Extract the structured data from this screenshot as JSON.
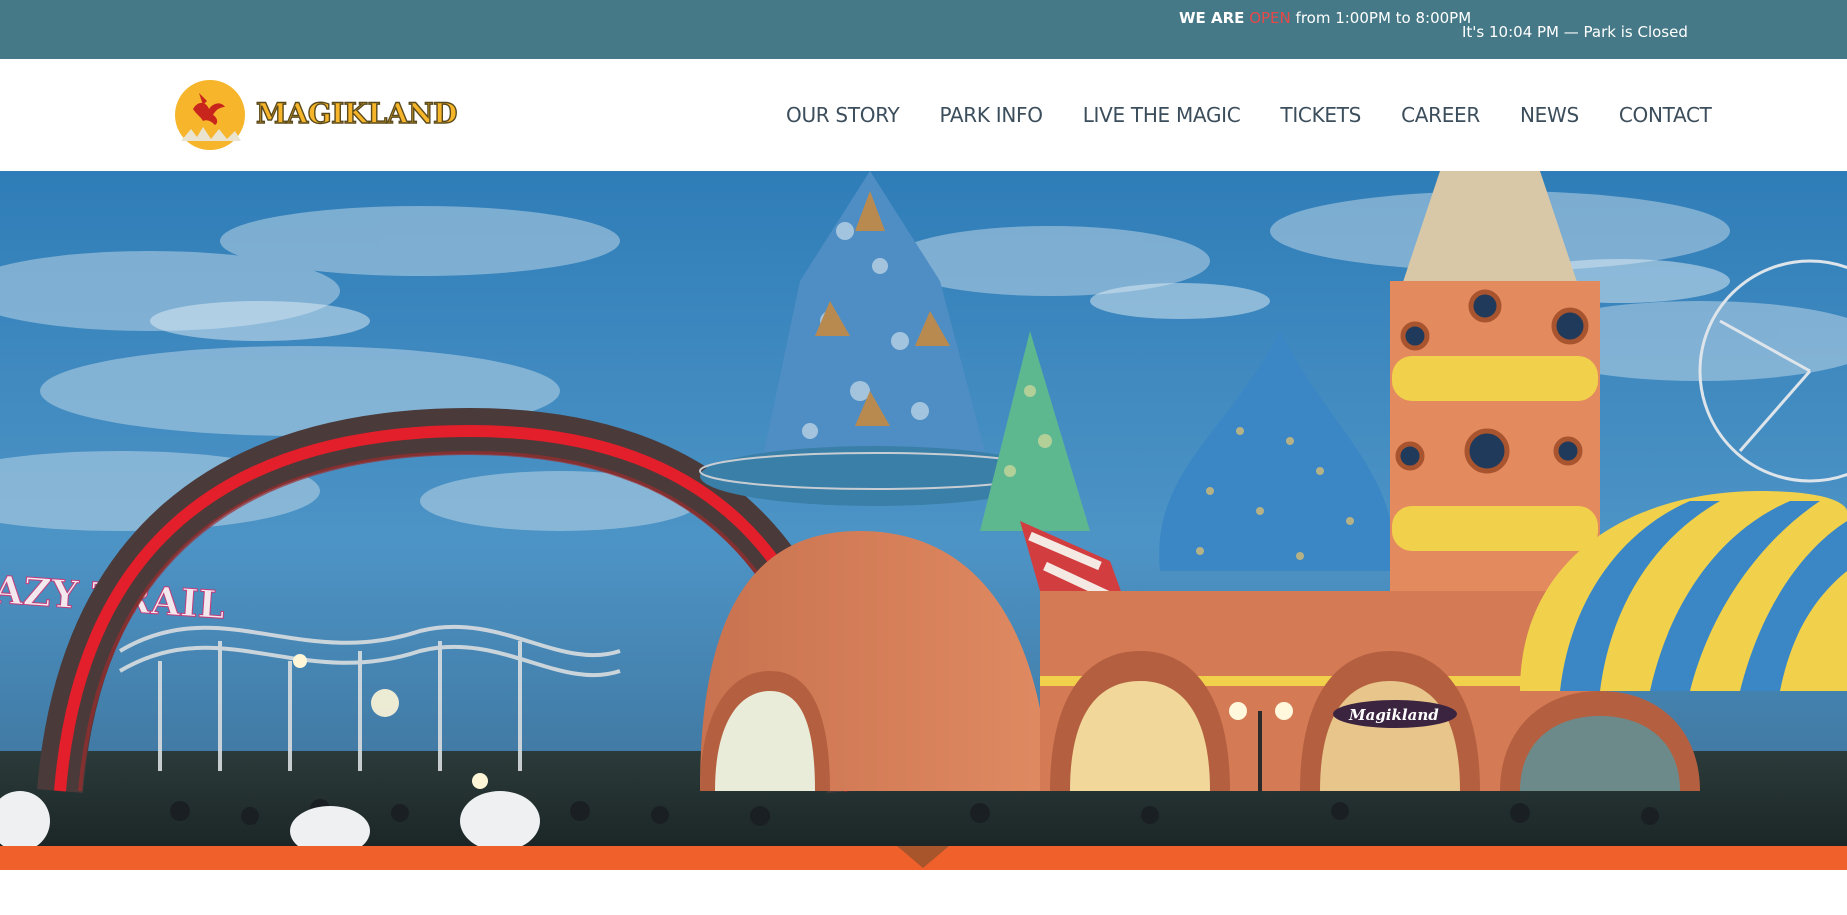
{
  "topbar": {
    "we_are": "WE ARE",
    "open": "OPEN",
    "hours_text": " from 1:00PM to 8:00PM",
    "status": "It's 10:04 PM — Park is Closed"
  },
  "header": {
    "logo_text": "MAGIKLAND"
  },
  "nav": {
    "items": [
      {
        "label": "OUR STORY"
      },
      {
        "label": "PARK INFO"
      },
      {
        "label": "LIVE THE MAGIC"
      },
      {
        "label": "TICKETS"
      },
      {
        "label": "CAREER"
      },
      {
        "label": "NEWS"
      },
      {
        "label": "CONTACT"
      }
    ]
  },
  "hero": {
    "sign_text": "AZY TRAIL",
    "shop_sign": "Magikland"
  },
  "colors": {
    "topbar_bg": "#467987",
    "accent_orange": "#f0602b",
    "open_red": "#e8484a",
    "nav_text": "#3c4e5c"
  },
  "icons": {
    "logo": "dragon-moon-logo-icon"
  }
}
